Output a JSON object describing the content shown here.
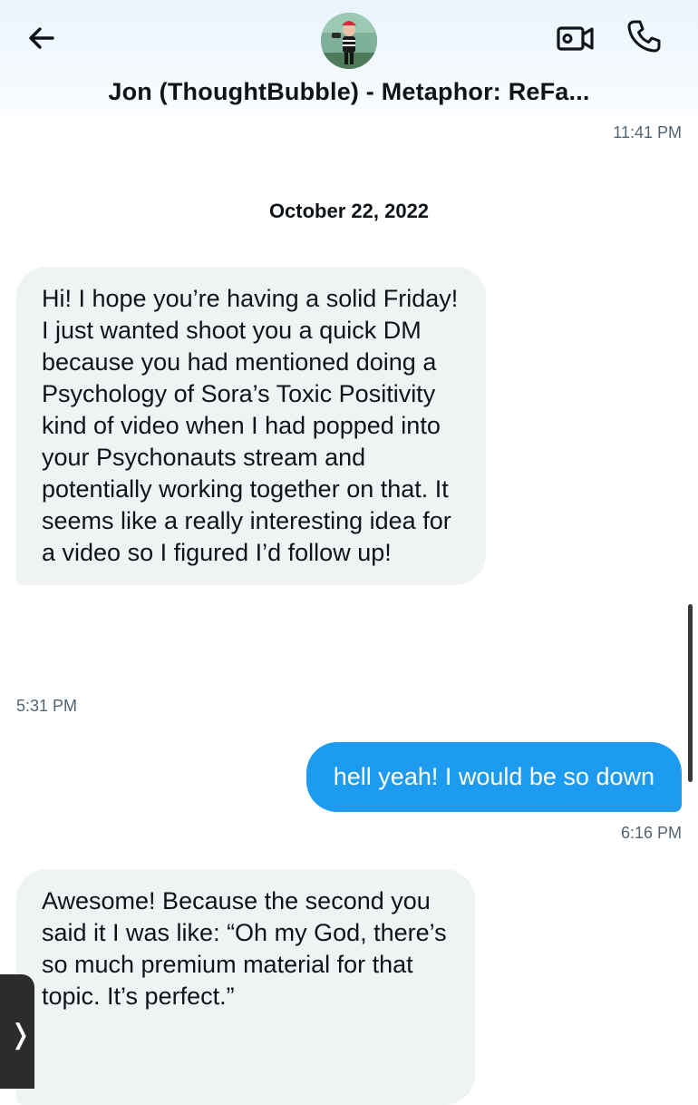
{
  "header": {
    "title": "Jon (ThoughtBubble) - Metaphor: ReFa...",
    "back_icon": "back-arrow-icon",
    "video_icon": "video-camera-icon",
    "phone_icon": "phone-icon"
  },
  "messages": {
    "prev_timestamp": "11:41 PM",
    "date_separator": "October 22, 2022",
    "m1": {
      "text": "Hi! I hope you’re having a solid Friday! I just wanted shoot you a quick DM because you had mentioned doing a Psychology of Sora’s Toxic Positivity kind of video when I had popped into your Psychonauts stream and potentially working together on that. It seems like a really interesting idea for a video so I figured I’d follow up!",
      "time": "5:31 PM"
    },
    "m2": {
      "text": "hell yeah! I would be so down",
      "time": "6:16 PM"
    },
    "m3": {
      "text": "Awesome! Because the second you said it I was like: “Oh my God, there’s so much premium material for that topic. It’s perfect.”"
    }
  },
  "colors": {
    "accent": "#1d9bf0",
    "incoming_bubble": "#eff3f4",
    "secondary_text": "#536471"
  },
  "drawer": {
    "glyph": "❭"
  }
}
